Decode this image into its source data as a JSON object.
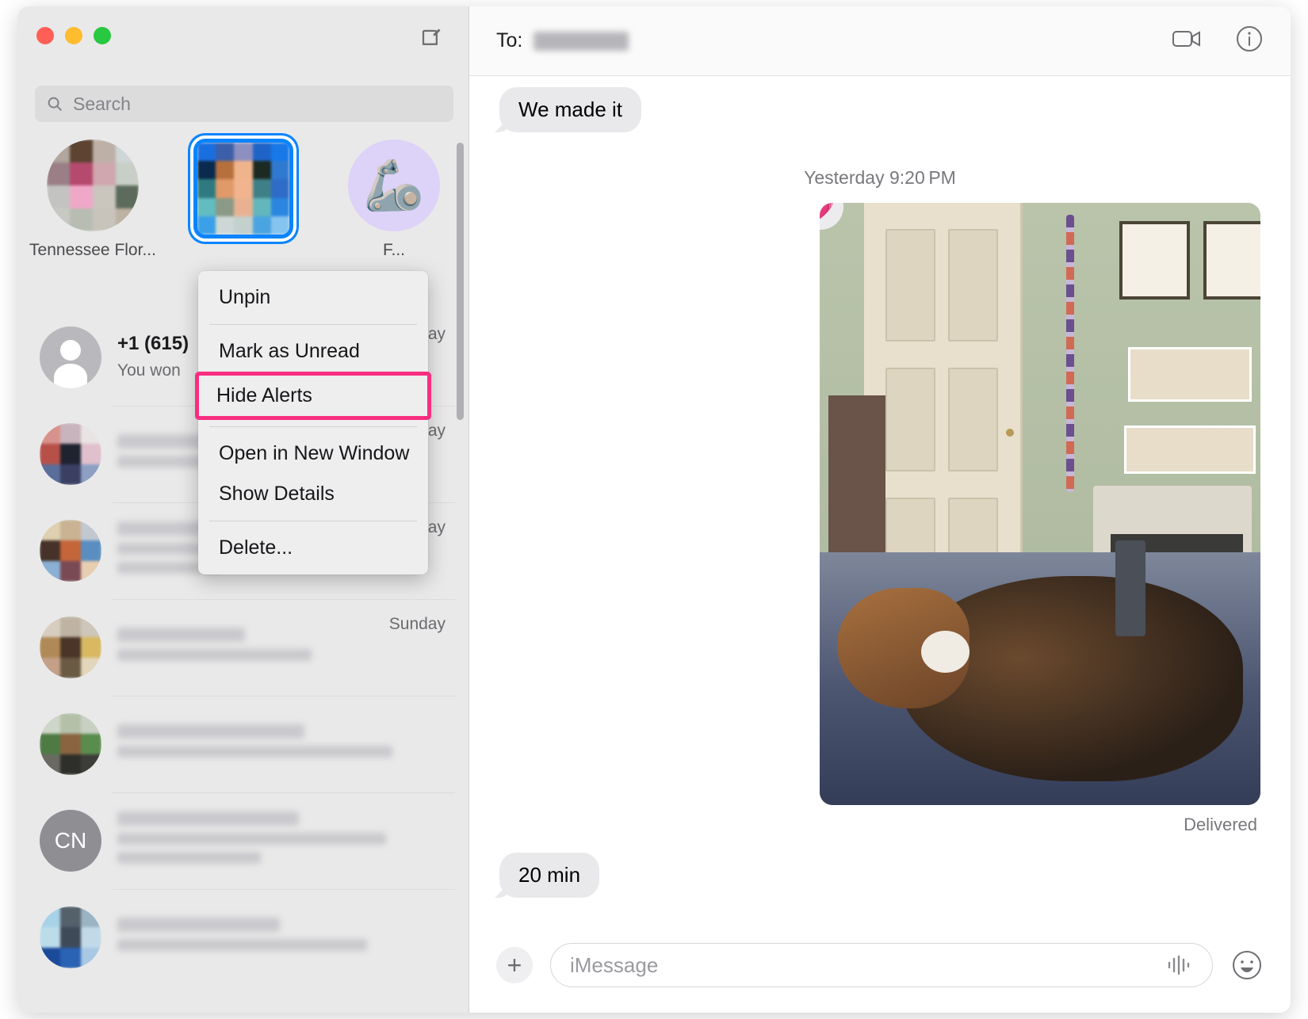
{
  "window": {
    "traffic_lights": {
      "close_label": "close",
      "minimize_label": "minimize",
      "zoom_label": "zoom",
      "close_color": "#ff5f57",
      "minimize_color": "#febc2e",
      "zoom_color": "#28c840"
    },
    "compose_icon": "compose-icon"
  },
  "sidebar": {
    "search": {
      "placeholder": "Search",
      "icon": "search-icon"
    },
    "pinned": [
      {
        "label": "Tennessee Flor...",
        "avatar_type": "mosaic",
        "selected": false
      },
      {
        "label": "",
        "avatar_type": "mosaic-blue",
        "selected": true
      },
      {
        "label": "F...",
        "avatar_type": "emoji",
        "emoji": "🦾",
        "selected": false
      }
    ],
    "conversations": [
      {
        "title": "+1 (615)",
        "preview": "You won",
        "time": "ay",
        "avatar_type": "person",
        "blurred": false
      },
      {
        "title": "",
        "preview": "",
        "time": "ay",
        "avatar_type": "mosaic-red",
        "blurred": true
      },
      {
        "title": "",
        "preview": "",
        "time": "Monday",
        "avatar_type": "mosaic-warm",
        "blurred": true
      },
      {
        "title": "",
        "preview": "",
        "time": "Sunday",
        "avatar_type": "mosaic-tan",
        "blurred": true
      },
      {
        "title": "",
        "preview": "",
        "time": "",
        "avatar_type": "mosaic-green",
        "blurred": true
      },
      {
        "title": "",
        "preview": "",
        "time": "",
        "avatar_type": "initials",
        "initials": "CN",
        "blurred": true
      },
      {
        "title": "",
        "preview": "",
        "time": "",
        "avatar_type": "mosaic-blue2",
        "blurred": true
      }
    ]
  },
  "context_menu": {
    "items": [
      {
        "label": "Unpin",
        "highlighted": false
      },
      {
        "label": "Mark as Unread",
        "highlighted": false
      },
      {
        "label": "Hide Alerts",
        "highlighted": true
      },
      {
        "label": "Open in New Window",
        "highlighted": false
      },
      {
        "label": "Show Details",
        "highlighted": false
      },
      {
        "label": "Delete...",
        "highlighted": false
      }
    ],
    "highlight_color": "#f82e80"
  },
  "conversation": {
    "header": {
      "to_label": "To:",
      "recipient_blurred": true,
      "facetime_icon": "video-camera-icon",
      "info_icon": "info-circle-icon"
    },
    "messages": [
      {
        "type": "incoming",
        "text": "We made it"
      },
      {
        "type": "daystamp",
        "text": "Yesterday 9:20 PM"
      },
      {
        "type": "photo",
        "tapback": "💗",
        "status": "Delivered"
      },
      {
        "type": "incoming",
        "text": "20 min"
      }
    ],
    "composer": {
      "plus_icon": "plus-icon",
      "placeholder": "iMessage",
      "audio_icon": "audio-waveform-icon",
      "emoji_icon": "emoji-smiley-icon"
    }
  }
}
